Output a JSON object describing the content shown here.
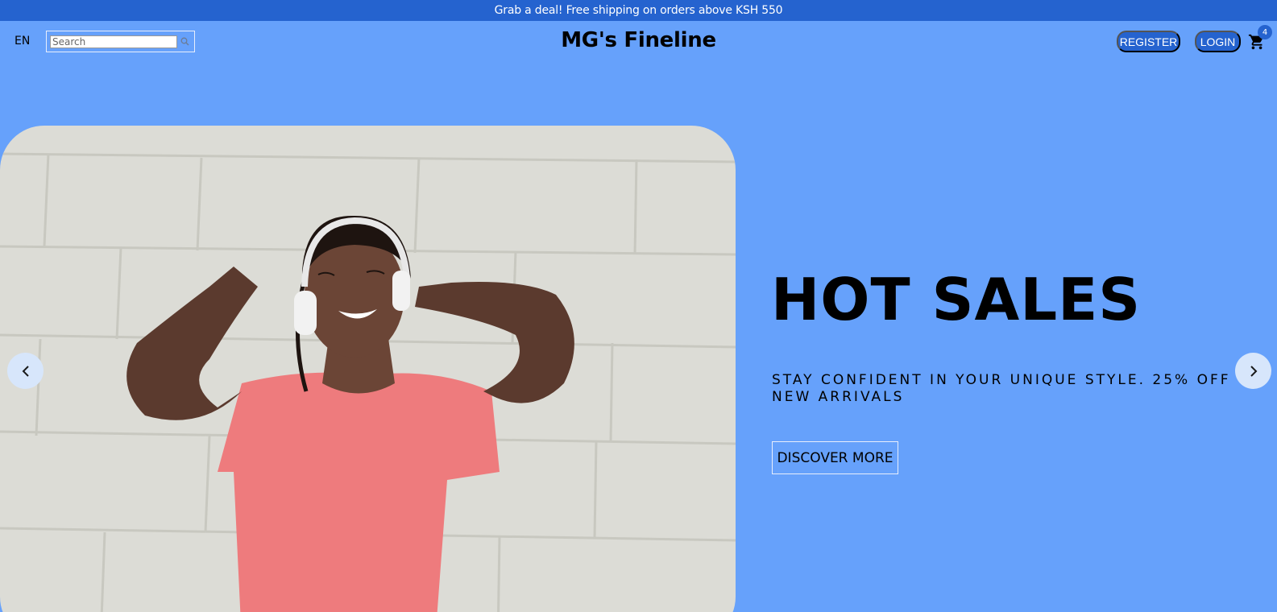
{
  "announcement": {
    "text": "Grab a deal! Free shipping on orders above KSH 550"
  },
  "nav": {
    "language": "EN",
    "search": {
      "placeholder": "Search",
      "value": ""
    },
    "brand": "MG's Fineline",
    "register_label": "REGISTER",
    "login_label": "LOGIN",
    "cart_count": "4"
  },
  "hero": {
    "title": "HOT SALES",
    "description": "STAY CONFIDENT IN YOUR UNIQUE STYLE. 25% OFF NEW ARRIVALS",
    "cta_label": "DISCOVER MORE"
  },
  "icons": {
    "search": "search-icon",
    "cart": "cart-icon",
    "prev": "arrow-left-icon",
    "next": "arrow-right-icon"
  },
  "colors": {
    "background": "#66a1fb",
    "accent": "#2563cf",
    "shirt": "#ee7b7d"
  }
}
